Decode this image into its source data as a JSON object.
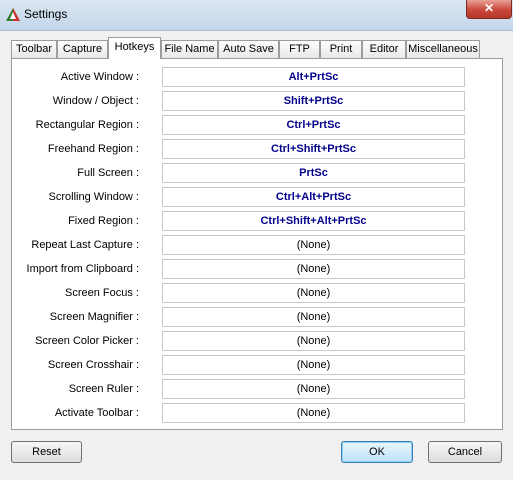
{
  "window": {
    "title": "Settings",
    "close_glyph": "✕"
  },
  "tabs": [
    {
      "label": "Toolbar",
      "active": false
    },
    {
      "label": "Capture",
      "active": false
    },
    {
      "label": "Hotkeys",
      "active": true
    },
    {
      "label": "File Name",
      "active": false
    },
    {
      "label": "Auto Save",
      "active": false
    },
    {
      "label": "FTP",
      "active": false
    },
    {
      "label": "Print",
      "active": false
    },
    {
      "label": "Editor",
      "active": false
    },
    {
      "label": "Miscellaneous",
      "active": false
    }
  ],
  "hotkeys": [
    {
      "label": "Active Window :",
      "value": "Alt+PrtSc"
    },
    {
      "label": "Window / Object :",
      "value": "Shift+PrtSc"
    },
    {
      "label": "Rectangular Region :",
      "value": "Ctrl+PrtSc"
    },
    {
      "label": "Freehand Region :",
      "value": "Ctrl+Shift+PrtSc"
    },
    {
      "label": "Full Screen :",
      "value": "PrtSc"
    },
    {
      "label": "Scrolling Window :",
      "value": "Ctrl+Alt+PrtSc"
    },
    {
      "label": "Fixed Region :",
      "value": "Ctrl+Shift+Alt+PrtSc"
    },
    {
      "label": "Repeat Last Capture :",
      "value": "(None)"
    },
    {
      "label": "Import from Clipboard :",
      "value": "(None)"
    },
    {
      "label": "Screen Focus :",
      "value": "(None)"
    },
    {
      "label": "Screen Magnifier :",
      "value": "(None)"
    },
    {
      "label": "Screen Color Picker :",
      "value": "(None)"
    },
    {
      "label": "Screen Crosshair :",
      "value": "(None)"
    },
    {
      "label": "Screen Ruler :",
      "value": "(None)"
    },
    {
      "label": "Activate Toolbar :",
      "value": "(None)"
    }
  ],
  "buttons": {
    "reset": "Reset",
    "ok": "OK",
    "cancel": "Cancel"
  },
  "colors": {
    "assigned_hotkey": "#00008b",
    "unassigned_hotkey": "#000000"
  }
}
